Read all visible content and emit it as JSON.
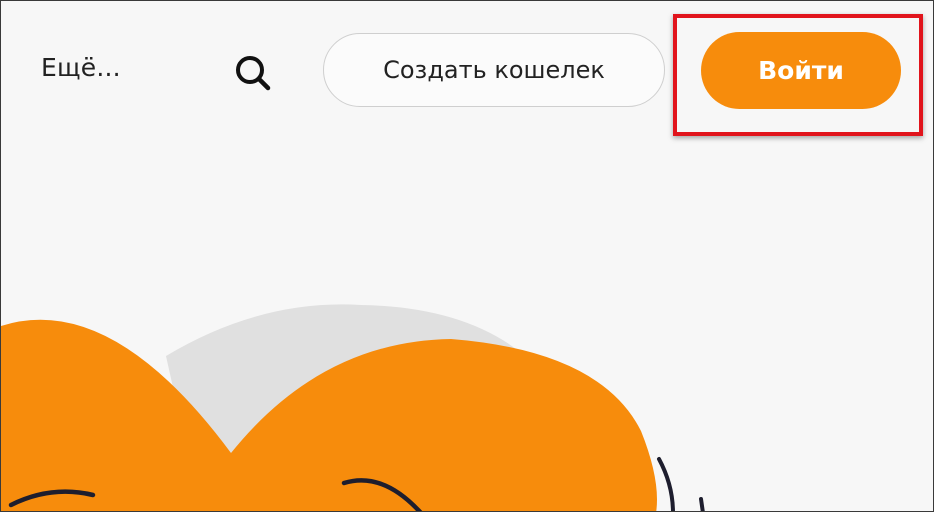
{
  "header": {
    "more_label": "Ещё...",
    "search_icon": "search-icon",
    "create_wallet_label": "Создать кошелек",
    "login_label": "Войти"
  },
  "colors": {
    "accent": "#f78c0c",
    "highlight": "#e1141c",
    "background": "#f7f7f7"
  }
}
